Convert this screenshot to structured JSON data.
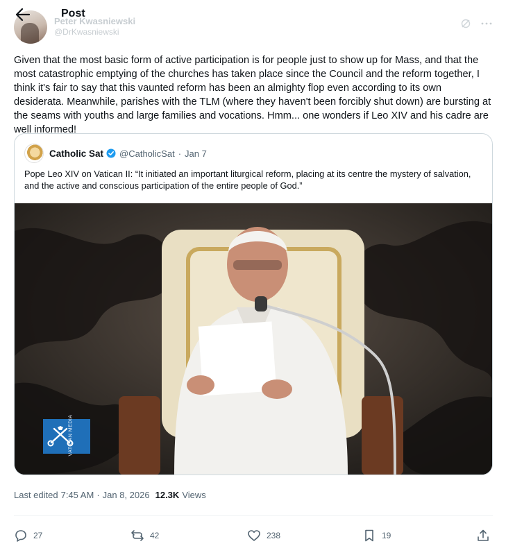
{
  "header": {
    "title": "Post",
    "author_name": "Peter Kwasniewski",
    "author_handle": "@DrKwasniewski"
  },
  "post": {
    "text": "Given that the most basic form of active participation is for people just to show up for Mass, and that the most catastrophic emptying of the churches has taken place since the Council and the reform together, I think it's fair to say that this vaunted reform has been an almighty flop even according to its own desiderata. Meanwhile, parishes with the TLM (where they haven't been forcibly shut down) are bursting at the seams with youths and large families and vocations. Hmm... one wonders if Leo XIV and his cadre are well informed!"
  },
  "quote": {
    "name": "Catholic Sat",
    "handle": "@CatholicSat",
    "dot": "·",
    "date": "Jan 7",
    "text": "Pope Leo XIV on Vatican II: “It initiated an important liturgical reform, placing at its centre the mystery of salvation, and the active and conscious participation of the entire people of God.”",
    "media_watermark": "VATICAN MEDIA"
  },
  "meta": {
    "edited_label": "Last edited",
    "time": "7:45 AM",
    "dot": "·",
    "date": "Jan 8, 2026",
    "views_count": "12.3K",
    "views_label": "Views"
  },
  "actions": {
    "replies": "27",
    "reposts": "42",
    "likes": "238",
    "bookmarks": "19"
  },
  "colors": {
    "text": "#0f1419",
    "secondary": "#536471",
    "verified": "#1d9bf0",
    "border": "#cfd9de"
  }
}
